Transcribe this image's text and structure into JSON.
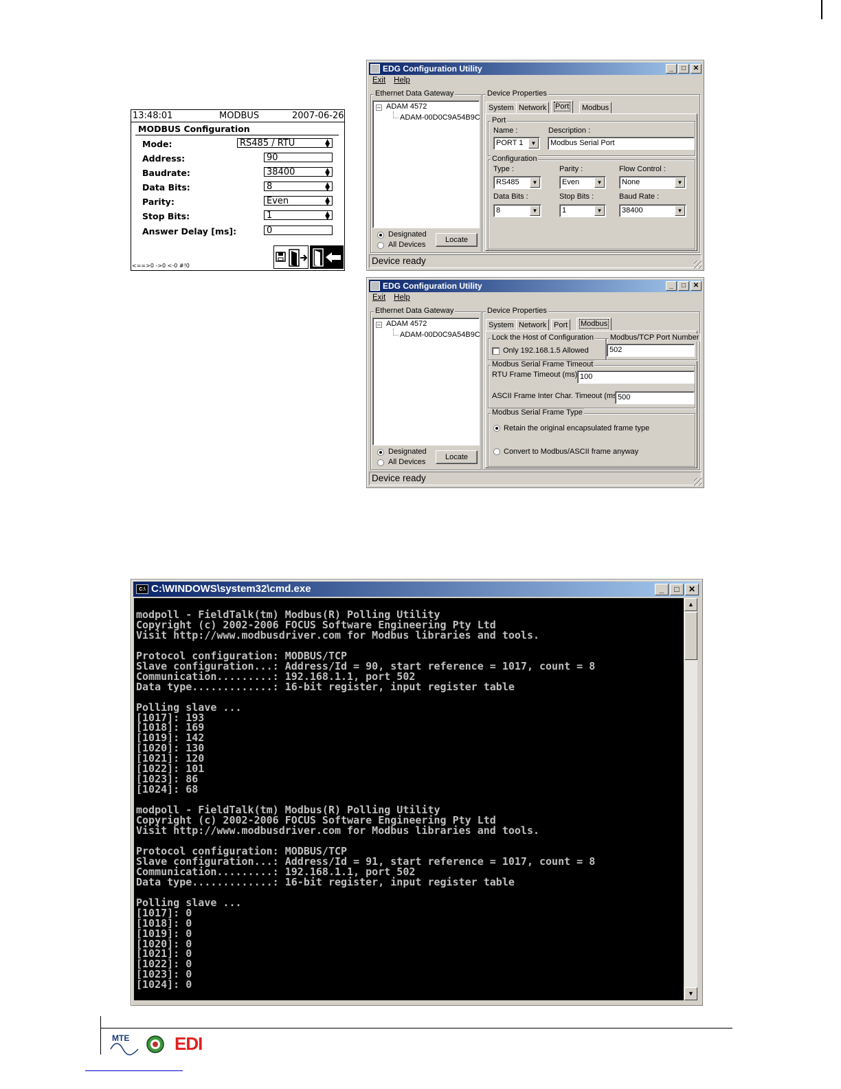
{
  "lcd": {
    "time": "13:48:01",
    "title": "MODBUS",
    "date": "2007-06-26",
    "subtitle": "MODBUS Configuration",
    "rows": [
      {
        "label": "Mode:",
        "value": "RS485 / RTU"
      },
      {
        "label": "Address:",
        "value": "90"
      },
      {
        "label": "Baudrate:",
        "value": "38400"
      },
      {
        "label": "Data Bits:",
        "value": "8"
      },
      {
        "label": "Parity:",
        "value": "Even"
      },
      {
        "label": "Stop Bits:",
        "value": "1"
      },
      {
        "label": "Answer Delay [ms]:",
        "value": "0"
      }
    ],
    "footer": "<==>0 ->0 <-0 #!0"
  },
  "edg": {
    "title": "EDG Configuration Utility",
    "menu": [
      "Exit",
      "Help"
    ],
    "gateway_label": "Ethernet Data Gateway",
    "tree_root": "ADAM 4572",
    "tree_child": "ADAM-00D0C9A54B9C",
    "radio_designated": "Designated",
    "radio_all": "All Devices",
    "locate": "Locate",
    "device_props": "Device Properties",
    "tabs": [
      "System",
      "Network",
      "Port",
      "Modbus"
    ],
    "status": "Device ready"
  },
  "port_tab": {
    "port_group": "Port",
    "name_label": "Name :",
    "name_value": "PORT 1",
    "desc_label": "Description :",
    "desc_value": "Modbus Serial Port",
    "config_group": "Configuration",
    "type_label": "Type :",
    "type_value": "RS485",
    "parity_label": "Parity :",
    "parity_value": "Even",
    "flow_label": "Flow Control :",
    "flow_value": "None",
    "databits_label": "Data Bits :",
    "databits_value": "8",
    "stopbits_label": "Stop Bits :",
    "stopbits_value": "1",
    "baud_label": "Baud Rate :",
    "baud_value": "38400"
  },
  "modbus_tab": {
    "lock_group": "Lock the Host of Configuration",
    "lock_check": "Only 192.168.1.5 Allowed",
    "port_group": "Modbus/TCP Port Number",
    "port_value": "502",
    "timeout_group": "Modbus Serial Frame Timeout",
    "rtu_label": "RTU Frame Timeout (ms) :",
    "rtu_value": "100",
    "ascii_label": "ASCII Frame Inter Char. Timeout (ms) :",
    "ascii_value": "500",
    "frametype_group": "Modbus Serial Frame Type",
    "retain_label": "Retain the original encapsulated frame type",
    "convert_label": "Convert to Modbus/ASCII frame anyway"
  },
  "cmd": {
    "icon_text": "C:\\",
    "title": "C:\\WINDOWS\\system32\\cmd.exe",
    "lines": [
      "modpoll - FieldTalk(tm) Modbus(R) Polling Utility",
      "Copyright (c) 2002-2006 FOCUS Software Engineering Pty Ltd",
      "Visit http://www.modbusdriver.com for Modbus libraries and tools.",
      "",
      "Protocol configuration: MODBUS/TCP",
      "Slave configuration...: Address/Id = 90, start reference = 1017, count = 8",
      "Communication.........: 192.168.1.1, port 502",
      "Data type.............: 16-bit register, input register table",
      "",
      "Polling slave ...",
      "[1017]: 193",
      "[1018]: 169",
      "[1019]: 142",
      "[1020]: 130",
      "[1021]: 120",
      "[1022]: 101",
      "[1023]: 86",
      "[1024]: 68",
      "",
      "modpoll - FieldTalk(tm) Modbus(R) Polling Utility",
      "Copyright (c) 2002-2006 FOCUS Software Engineering Pty Ltd",
      "Visit http://www.modbusdriver.com for Modbus libraries and tools.",
      "",
      "Protocol configuration: MODBUS/TCP",
      "Slave configuration...: Address/Id = 91, start reference = 1017, count = 8",
      "Communication.........: 192.168.1.1, port 502",
      "Data type.............: 16-bit register, input register table",
      "",
      "Polling slave ...",
      "[1017]: 0",
      "[1018]: 0",
      "[1019]: 0",
      "[1020]: 0",
      "[1021]: 0",
      "[1022]: 0",
      "[1023]: 0",
      "[1024]: 0"
    ]
  },
  "footer_logo": {
    "mte": "MTE",
    "edi": "EDI",
    "edi_color": "#e02020"
  }
}
